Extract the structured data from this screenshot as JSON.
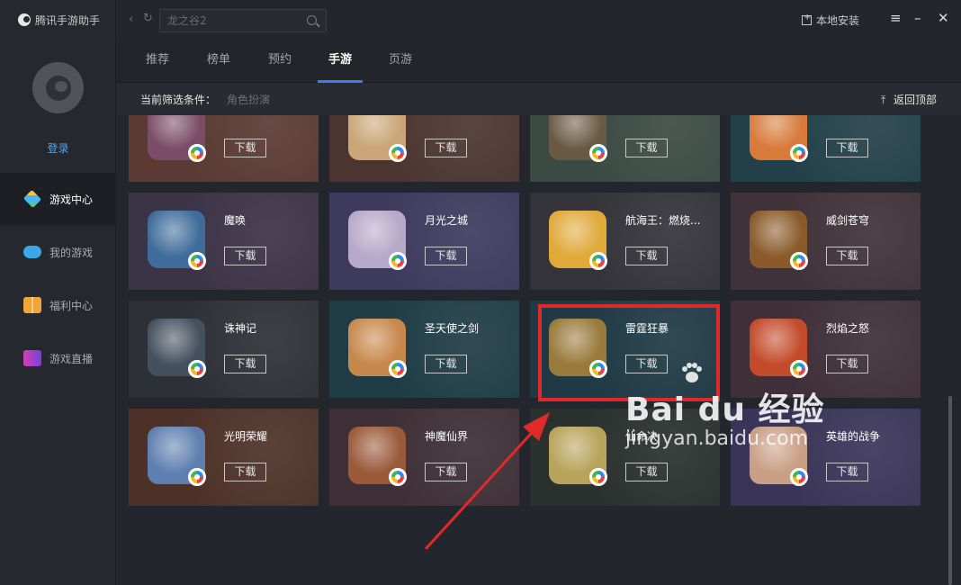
{
  "app": {
    "title": "腾讯手游助手",
    "login": "登录"
  },
  "sidebar": {
    "items": [
      {
        "label": "游戏中心",
        "icon": "game-center-icon",
        "color": "#4bb6f0",
        "active": true
      },
      {
        "label": "我的游戏",
        "icon": "gamepad-icon",
        "color": "#3aa7e8",
        "active": false
      },
      {
        "label": "福利中心",
        "icon": "gift-icon",
        "color": "#f2a33a",
        "active": false
      },
      {
        "label": "游戏直播",
        "icon": "live-icon",
        "color": "#d23fb3",
        "active": false
      }
    ]
  },
  "toolbar": {
    "search_placeholder": "龙之谷2",
    "local_install": "本地安装"
  },
  "tabs": [
    {
      "label": "推荐",
      "active": false
    },
    {
      "label": "榜单",
      "active": false
    },
    {
      "label": "预约",
      "active": false
    },
    {
      "label": "手游",
      "active": true
    },
    {
      "label": "页游",
      "active": false
    }
  ],
  "filter": {
    "label": "当前筛选条件：",
    "value": "角色扮演",
    "back_to_top": "返回顶部"
  },
  "download_label": "下载",
  "accent_color": "#3f7bf0",
  "highlight_color": "#e02a2a",
  "games": [
    {
      "name": "",
      "bg": "#5a3a33",
      "icon": "#7a4c66"
    },
    {
      "name": "",
      "bg": "#4c3530",
      "icon": "#c9a578"
    },
    {
      "name": "",
      "bg": "#3b4a43",
      "icon": "#6a5a44"
    },
    {
      "name": "",
      "bg": "#23404a",
      "icon": "#d77a3a"
    },
    {
      "name": "魔唤",
      "bg": "#3b3346",
      "icon": "#3f6c9a"
    },
    {
      "name": "月光之城",
      "bg": "#3d3a5e",
      "icon": "#b7a9c9"
    },
    {
      "name": "航海王：燃烧...",
      "bg": "#333339",
      "icon": "#e0a93a"
    },
    {
      "name": "威剑苍穹",
      "bg": "#3f3238",
      "icon": "#8a5a2a"
    },
    {
      "name": "诛神记",
      "bg": "#2e3037",
      "icon": "#45505e"
    },
    {
      "name": "圣天使之剑",
      "bg": "#1f3c46",
      "icon": "#c7884c"
    },
    {
      "name": "雷霆狂暴",
      "bg": "#1f3a45",
      "icon": "#9a7a3c"
    },
    {
      "name": "烈焰之怒",
      "bg": "#3e2f38",
      "icon": "#c34a2a"
    },
    {
      "name": "光明荣耀",
      "bg": "#4d3128",
      "icon": "#5f7fb0"
    },
    {
      "name": "神魔仙界",
      "bg": "#3d2f35",
      "icon": "#9a5a3a"
    },
    {
      "name": "仙命决",
      "bg": "#2a302e",
      "icon": "#b7a35a"
    },
    {
      "name": "英雄的战争",
      "bg": "#3a3558",
      "icon": "#c99f86"
    }
  ],
  "watermark": {
    "brand": "Bai du 经验",
    "url": "jingyan.baidu.com"
  }
}
